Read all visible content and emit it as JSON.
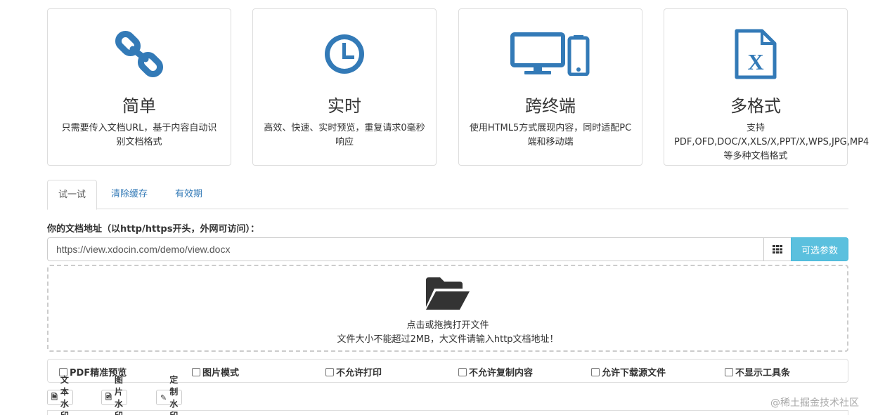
{
  "features": [
    {
      "icon": "link-icon",
      "title": "简单",
      "desc": "只需要传入文档URL，基于内容自动识别文档格式"
    },
    {
      "icon": "clock-icon",
      "title": "实时",
      "desc": "高效、快速、实时预览，重复请求0毫秒响应"
    },
    {
      "icon": "devices-icon",
      "title": "跨终端",
      "desc": "使用HTML5方式展现内容，同时适配PC端和移动端"
    },
    {
      "icon": "excel-file-icon",
      "title": "多格式",
      "desc": "支持PDF,OFD,DOC/X,XLS/X,PPT/X,WPS,JPG,MP4等多种文档格式"
    }
  ],
  "tabs": [
    "试一试",
    "清除缓存",
    "有效期"
  ],
  "form": {
    "label": "你的文档地址（以http/https开头，外网可访问）：",
    "url_value": "https://view.xdocin.com/demo/view.docx",
    "options_button": "可选参数"
  },
  "dropzone": {
    "line1": "点击或拖拽打开文件",
    "line2": "文件大小不能超过2MB，大文件请输入http文档地址！"
  },
  "checkboxes": [
    "PDF精准预览",
    "图片模式",
    "不允许打印",
    "不允许复制内容",
    "允许下载源文件",
    "不显示工具条"
  ],
  "watermark_buttons": [
    "文本水印",
    "图片水印",
    "定制水印"
  ],
  "page_watermark": "@稀土掘金技术社区",
  "colors": {
    "accent": "#337ab7",
    "info": "#5bc0de"
  }
}
